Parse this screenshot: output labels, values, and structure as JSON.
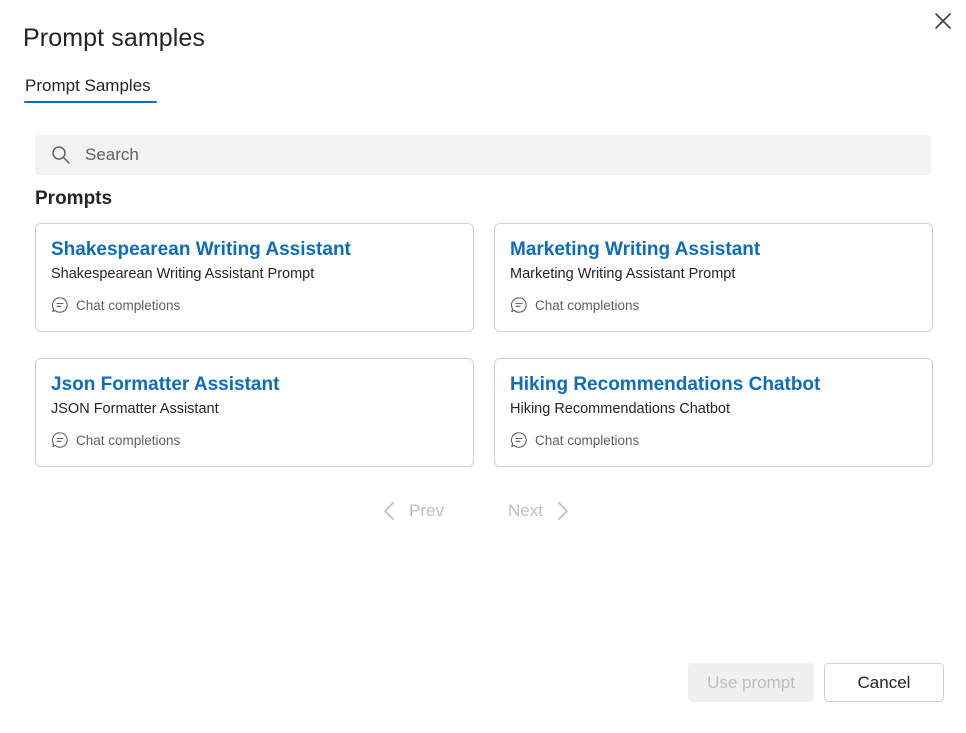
{
  "dialog": {
    "title": "Prompt samples"
  },
  "tabs": [
    {
      "label": "Prompt Samples",
      "selected": true
    }
  ],
  "search": {
    "placeholder": "Search",
    "value": ""
  },
  "section": {
    "title": "Prompts"
  },
  "cards": [
    {
      "title": "Shakespearean Writing Assistant",
      "description": "Shakespearean Writing Assistant Prompt",
      "tag": "Chat completions",
      "tag_icon": "chat-icon"
    },
    {
      "title": "Marketing Writing Assistant",
      "description": "Marketing Writing Assistant Prompt",
      "tag": "Chat completions",
      "tag_icon": "chat-icon"
    },
    {
      "title": "Json Formatter Assistant",
      "description": "JSON Formatter Assistant",
      "tag": "Chat completions",
      "tag_icon": "chat-icon"
    },
    {
      "title": "Hiking Recommendations Chatbot",
      "description": "Hiking Recommendations Chatbot",
      "tag": "Chat completions",
      "tag_icon": "chat-icon"
    }
  ],
  "pagination": {
    "prev_label": "Prev",
    "next_label": "Next",
    "prev_disabled": true,
    "next_disabled": true
  },
  "footer": {
    "use_prompt_label": "Use prompt",
    "use_prompt_disabled": true,
    "cancel_label": "Cancel"
  },
  "colors": {
    "accent": "#0f6cbd",
    "disabled_text": "#bdbdbd",
    "card_border": "#d1d1d1"
  }
}
